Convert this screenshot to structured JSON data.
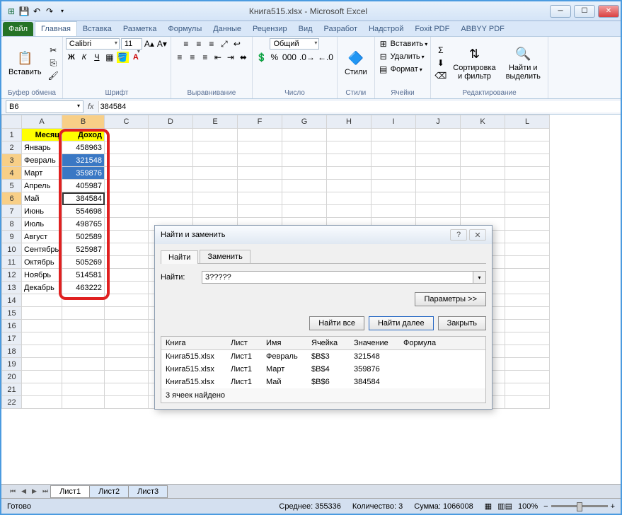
{
  "window": {
    "title": "Книга515.xlsx - Microsoft Excel"
  },
  "ribbon_tabs": [
    "Файл",
    "Главная",
    "Вставка",
    "Разметка",
    "Формулы",
    "Данные",
    "Рецензир",
    "Вид",
    "Разработ",
    "Надстрой",
    "Foxit PDF",
    "ABBYY PDF"
  ],
  "active_tab": "Главная",
  "ribbon": {
    "clipboard": {
      "paste": "Вставить",
      "label": "Буфер обмена"
    },
    "font": {
      "name": "Calibri",
      "size": "11",
      "label": "Шрифт"
    },
    "alignment": {
      "label": "Выравнивание"
    },
    "number": {
      "format": "Общий",
      "label": "Число"
    },
    "styles": {
      "label": "Стили",
      "styles_btn": "Стили"
    },
    "cells": {
      "insert": "Вставить",
      "delete": "Удалить",
      "format": "Формат",
      "label": "Ячейки"
    },
    "editing": {
      "sort": "Сортировка\nи фильтр",
      "find": "Найти и\nвыделить",
      "label": "Редактирование"
    }
  },
  "namebox": "B6",
  "formula": "384584",
  "columns": [
    "A",
    "B",
    "C",
    "D",
    "E",
    "F",
    "G",
    "H",
    "I",
    "J",
    "K",
    "L"
  ],
  "rows": [
    {
      "r": 1,
      "A": "Месяц",
      "B": "Доход",
      "hdr": true
    },
    {
      "r": 2,
      "A": "Январь",
      "B": "458963"
    },
    {
      "r": 3,
      "A": "Февраль",
      "B": "321548",
      "sel": true
    },
    {
      "r": 4,
      "A": "Март",
      "B": "359876",
      "sel": true
    },
    {
      "r": 5,
      "A": "Апрель",
      "B": "405987"
    },
    {
      "r": 6,
      "A": "Май",
      "B": "384584",
      "active": true
    },
    {
      "r": 7,
      "A": "Июнь",
      "B": "554698"
    },
    {
      "r": 8,
      "A": "Июль",
      "B": "498765"
    },
    {
      "r": 9,
      "A": "Август",
      "B": "502589"
    },
    {
      "r": 10,
      "A": "Сентябрь",
      "B": "525987"
    },
    {
      "r": 11,
      "A": "Октябрь",
      "B": "505269"
    },
    {
      "r": 12,
      "A": "Ноябрь",
      "B": "514581"
    },
    {
      "r": 13,
      "A": "Декабрь",
      "B": "463222"
    }
  ],
  "extra_rows": [
    14,
    15,
    16,
    17,
    18,
    19,
    20,
    21,
    22
  ],
  "dialog": {
    "title": "Найти и заменить",
    "tab_find": "Найти",
    "tab_replace": "Заменить",
    "find_label": "Найти:",
    "find_value": "3?????",
    "params_btn": "Параметры >>",
    "btn_find_all": "Найти все",
    "btn_find_next": "Найти далее",
    "btn_close": "Закрыть",
    "results_hdr": [
      "Книга",
      "Лист",
      "Имя",
      "Ячейка",
      "Значение",
      "Формула"
    ],
    "results": [
      {
        "book": "Книга515.xlsx",
        "sheet": "Лист1",
        "name": "Февраль",
        "cell": "$B$3",
        "value": "321548"
      },
      {
        "book": "Книга515.xlsx",
        "sheet": "Лист1",
        "name": "Март",
        "cell": "$B$4",
        "value": "359876"
      },
      {
        "book": "Книга515.xlsx",
        "sheet": "Лист1",
        "name": "Май",
        "cell": "$B$6",
        "value": "384584"
      }
    ],
    "footer": "3 ячеек найдено"
  },
  "sheets": [
    "Лист1",
    "Лист2",
    "Лист3"
  ],
  "status": {
    "ready": "Готово",
    "avg_label": "Среднее:",
    "avg": "355336",
    "count_label": "Количество:",
    "count": "3",
    "sum_label": "Сумма:",
    "sum": "1066008",
    "zoom": "100%"
  }
}
